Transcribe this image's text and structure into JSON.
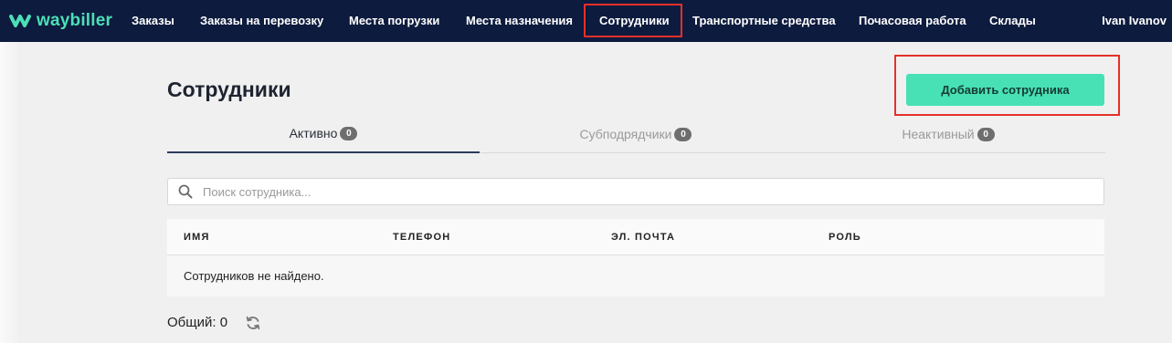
{
  "app": {
    "logo_text": "waybiller",
    "brand_color": "#47e1b5",
    "nav_bg": "#0d1b3e",
    "highlight_color": "#e5302a"
  },
  "nav": {
    "items": [
      {
        "label": "Заказы"
      },
      {
        "label": "Заказы на перевозку"
      },
      {
        "label": "Места погрузки"
      },
      {
        "label": "Места назначения"
      },
      {
        "label": "Сотрудники"
      },
      {
        "label": "Транспортные средства"
      },
      {
        "label": "Почасовая работа"
      },
      {
        "label": "Склады"
      }
    ],
    "active_item": "Сотрудники",
    "user_name": "Ivan Ivanov"
  },
  "page": {
    "title": "Сотрудники",
    "add_button_label": "Добавить сотрудника"
  },
  "tabs": [
    {
      "label": "Активно",
      "count": "0",
      "active": true
    },
    {
      "label": "Субподрядчики",
      "count": "0",
      "active": false
    },
    {
      "label": "Неактивный",
      "count": "0",
      "active": false
    }
  ],
  "search": {
    "placeholder": "Поиск сотрудника...",
    "value": "",
    "icon": "search-icon"
  },
  "table": {
    "columns": [
      "ИМЯ",
      "ТЕЛЕФОН",
      "ЭЛ. ПОЧТА",
      "РОЛЬ"
    ],
    "empty_message": "Сотрудников не найдено."
  },
  "footer": {
    "total_label": "Общий: 0",
    "refresh_icon": "refresh-icon"
  }
}
